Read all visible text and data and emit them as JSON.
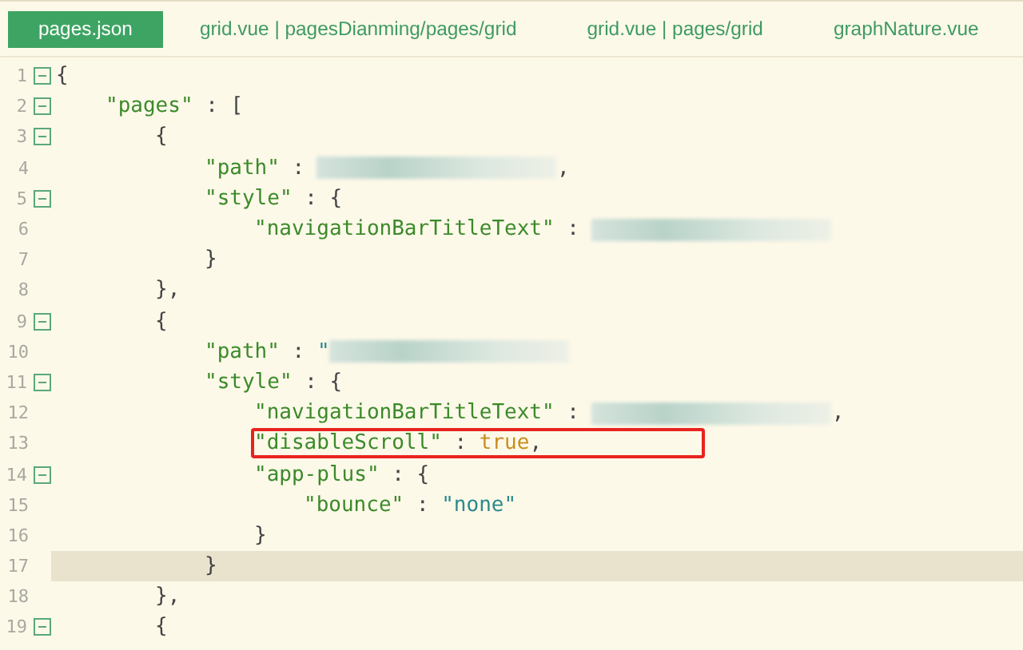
{
  "tabs": [
    {
      "label": "pages.json",
      "selected": true
    },
    {
      "label": "grid.vue | pagesDianming/pages/grid",
      "selected": false
    },
    {
      "label": "grid.vue | pages/grid",
      "selected": false
    },
    {
      "label": "graphNature.vue",
      "selected": false
    }
  ],
  "lines": [
    {
      "number": "1",
      "foldable": true,
      "current": false,
      "marked": false,
      "tokens": [
        {
          "kind": "punct",
          "text": "{"
        }
      ],
      "children": [
        {
          "number": "2",
          "foldable": true,
          "current": false,
          "marked": false,
          "tokens": [
            {
              "kind": "key",
              "text": "\"pages\""
            },
            {
              "kind": "punct",
              "text": " : ["
            }
          ],
          "children": [
            {
              "number": "3",
              "foldable": true,
              "current": false,
              "marked": false,
              "tokens": [
                {
                  "kind": "punct",
                  "text": "{"
                }
              ],
              "children": [
                {
                  "number": "4",
                  "foldable": false,
                  "current": false,
                  "marked": false,
                  "tokens": [
                    {
                      "kind": "key",
                      "text": "\"path\""
                    },
                    {
                      "kind": "punct",
                      "text": " : "
                    },
                    {
                      "kind": "redacted"
                    },
                    {
                      "kind": "punct",
                      "text": ","
                    }
                  ]
                },
                {
                  "number": "5",
                  "foldable": true,
                  "current": false,
                  "marked": false,
                  "tokens": [
                    {
                      "kind": "key",
                      "text": "\"style\""
                    },
                    {
                      "kind": "punct",
                      "text": " : {"
                    }
                  ],
                  "children": [
                    {
                      "number": "6",
                      "foldable": false,
                      "current": false,
                      "marked": false,
                      "tokens": [
                        {
                          "kind": "key",
                          "text": "\"navigationBarTitleText\""
                        },
                        {
                          "kind": "punct",
                          "text": " : "
                        },
                        {
                          "kind": "redacted"
                        }
                      ]
                    }
                  ]
                },
                {
                  "number": "7",
                  "foldable": false,
                  "current": false,
                  "marked": false,
                  "tokens": [
                    {
                      "kind": "punct",
                      "text": "}"
                    }
                  ]
                }
              ]
            },
            {
              "number": "8",
              "foldable": false,
              "current": false,
              "marked": false,
              "tokens": [
                {
                  "kind": "punct",
                  "text": "},"
                }
              ]
            },
            {
              "number": "9",
              "foldable": true,
              "current": false,
              "marked": false,
              "tokens": [
                {
                  "kind": "punct",
                  "text": "{"
                }
              ],
              "children": [
                {
                  "number": "10",
                  "foldable": false,
                  "current": false,
                  "marked": false,
                  "tokens": [
                    {
                      "kind": "key",
                      "text": "\"path\""
                    },
                    {
                      "kind": "punct",
                      "text": " : "
                    },
                    {
                      "kind": "string",
                      "text": "\""
                    },
                    {
                      "kind": "redacted"
                    }
                  ]
                },
                {
                  "number": "11",
                  "foldable": true,
                  "current": false,
                  "marked": false,
                  "tokens": [
                    {
                      "kind": "key",
                      "text": "\"style\""
                    },
                    {
                      "kind": "punct",
                      "text": " : {"
                    }
                  ],
                  "children": [
                    {
                      "number": "12",
                      "foldable": false,
                      "current": false,
                      "marked": false,
                      "tokens": [
                        {
                          "kind": "key",
                          "text": "\"navigationBarTitleText\""
                        },
                        {
                          "kind": "punct",
                          "text": " : "
                        },
                        {
                          "kind": "redacted"
                        },
                        {
                          "kind": "punct",
                          "text": ","
                        }
                      ]
                    },
                    {
                      "number": "13",
                      "foldable": false,
                      "current": false,
                      "marked": true,
                      "tokens": [
                        {
                          "kind": "key",
                          "text": "\"disableScroll\""
                        },
                        {
                          "kind": "punct",
                          "text": " : "
                        },
                        {
                          "kind": "keyword",
                          "text": "true"
                        },
                        {
                          "kind": "punct",
                          "text": ","
                        }
                      ]
                    },
                    {
                      "number": "14",
                      "foldable": true,
                      "current": false,
                      "marked": false,
                      "tokens": [
                        {
                          "kind": "key",
                          "text": "\"app-plus\""
                        },
                        {
                          "kind": "punct",
                          "text": " : {"
                        }
                      ],
                      "children": [
                        {
                          "number": "15",
                          "foldable": false,
                          "current": false,
                          "marked": false,
                          "tokens": [
                            {
                              "kind": "key",
                              "text": "\"bounce\""
                            },
                            {
                              "kind": "punct",
                              "text": " : "
                            },
                            {
                              "kind": "string",
                              "text": "\"none\""
                            }
                          ]
                        }
                      ]
                    },
                    {
                      "number": "16",
                      "foldable": false,
                      "current": false,
                      "marked": false,
                      "tokens": [
                        {
                          "kind": "punct",
                          "text": "}"
                        }
                      ]
                    }
                  ]
                },
                {
                  "number": "17",
                  "foldable": false,
                  "current": true,
                  "marked": false,
                  "tokens": [
                    {
                      "kind": "punct",
                      "text": "}"
                    }
                  ]
                }
              ]
            },
            {
              "number": "18",
              "foldable": false,
              "current": false,
              "marked": false,
              "tokens": [
                {
                  "kind": "punct",
                  "text": "},"
                }
              ]
            },
            {
              "number": "19",
              "foldable": true,
              "current": false,
              "marked": false,
              "tokens": [
                {
                  "kind": "punct",
                  "text": "{"
                }
              ]
            }
          ]
        }
      ]
    }
  ]
}
